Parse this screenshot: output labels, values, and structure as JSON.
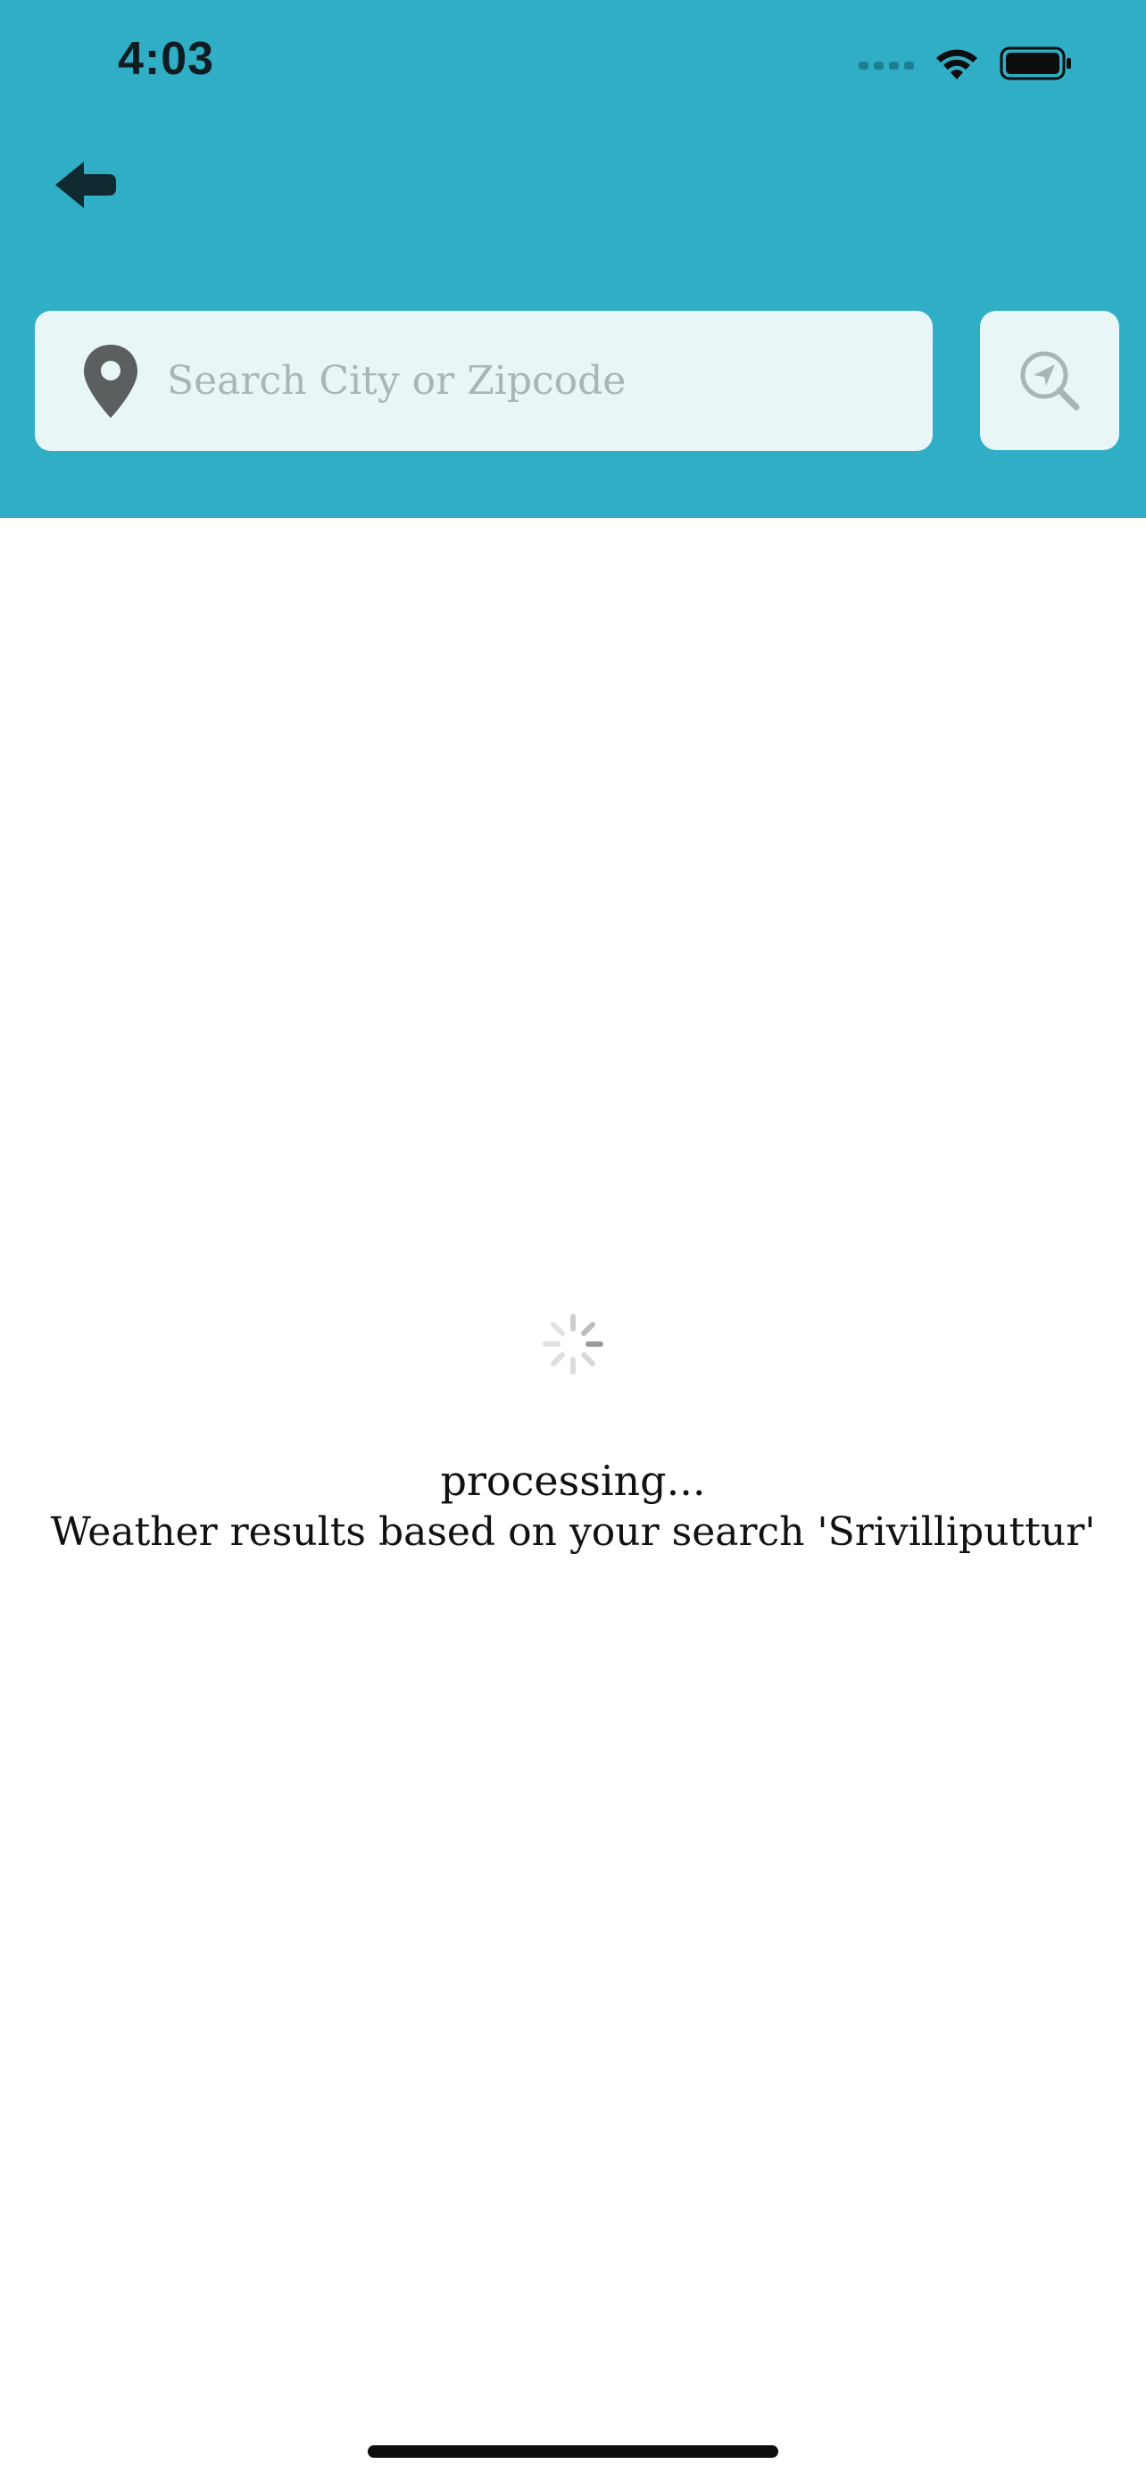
{
  "status_bar": {
    "time": "4:03",
    "icons": [
      "cellular-signal-icon",
      "wifi-icon",
      "battery-icon"
    ]
  },
  "header": {
    "background_color": "#30aec6",
    "back_icon": "back-arrow-icon"
  },
  "search": {
    "placeholder": "Search City or Zipcode",
    "value": "",
    "leading_icon": "location-pin-icon",
    "locate_icon": "location-search-icon"
  },
  "loading": {
    "status": "processing...",
    "message": "Weather results based on your search 'Srivilliputtur'"
  }
}
